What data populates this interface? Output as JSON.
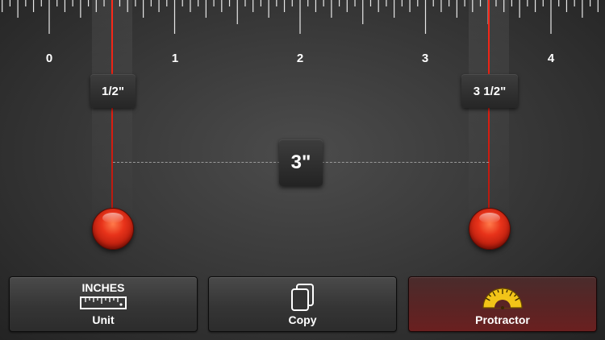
{
  "ruler": {
    "numbers": [
      "0",
      "1",
      "2",
      "3",
      "4"
    ]
  },
  "markers": {
    "left_label": "1/2\"",
    "right_label": "3 1/2\"",
    "distance_label": "3\"",
    "color": "#e8331a"
  },
  "toolbar": {
    "unit": {
      "title": "INCHES",
      "label": "Unit",
      "icon": "ruler-icon"
    },
    "copy": {
      "label": "Copy",
      "icon": "copy-icon"
    },
    "protractor": {
      "label": "Protractor",
      "icon": "protractor-icon",
      "accent": "#f0c020"
    }
  }
}
